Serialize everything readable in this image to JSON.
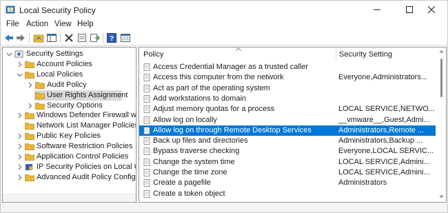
{
  "window": {
    "title": "Local Security Policy"
  },
  "menu": [
    "File",
    "Action",
    "View",
    "Help"
  ],
  "toolbar": {
    "buttons": [
      "back-arrow-icon",
      "forward-arrow-icon",
      "up-folder-icon",
      "show-hide-tree-icon",
      "delete-icon",
      "properties-icon",
      "export-list-icon",
      "help-icon",
      "console-icon"
    ]
  },
  "tree": {
    "items": [
      {
        "label": "Security Settings",
        "level": 0,
        "expanded": true
      },
      {
        "label": "Account Policies",
        "level": 1,
        "expanded": false
      },
      {
        "label": "Local Policies",
        "level": 1,
        "expanded": true
      },
      {
        "label": "Audit Policy",
        "level": 2,
        "expanded": false
      },
      {
        "label": "User Rights Assignment",
        "level": 2,
        "selected": true
      },
      {
        "label": "Security Options",
        "level": 2,
        "expanded": false
      },
      {
        "label": "Windows Defender Firewall with Adva",
        "level": 1,
        "expanded": false
      },
      {
        "label": "Network List Manager Policies",
        "level": 1
      },
      {
        "label": "Public Key Policies",
        "level": 1,
        "expanded": false
      },
      {
        "label": "Software Restriction Policies",
        "level": 1,
        "expanded": false
      },
      {
        "label": "Application Control Policies",
        "level": 1,
        "expanded": false
      },
      {
        "label": "IP Security Policies on Local Compute",
        "level": 1,
        "expanded": false
      },
      {
        "label": "Advanced Audit Policy Configuration",
        "level": 1,
        "expanded": false
      }
    ]
  },
  "list": {
    "columns": [
      "Policy",
      "Security Setting"
    ],
    "rows": [
      {
        "policy": "Access Credential Manager as a trusted caller",
        "setting": ""
      },
      {
        "policy": "Access this computer from the network",
        "setting": "Everyone,Administrators..."
      },
      {
        "policy": "Act as part of the operating system",
        "setting": ""
      },
      {
        "policy": "Add workstations to domain",
        "setting": ""
      },
      {
        "policy": "Adjust memory quotas for a process",
        "setting": "LOCAL SERVICE,NETWO..."
      },
      {
        "policy": "Allow log on locally",
        "setting": "__vmware__,Guest,Admi..."
      },
      {
        "policy": "Allow log on through Remote Desktop Services",
        "setting": "Administrators,Remote ...",
        "selected": true
      },
      {
        "policy": "Back up files and directories",
        "setting": "Administrators,Backup ..."
      },
      {
        "policy": "Bypass traverse checking",
        "setting": "Everyone,LOCAL SERVIC..."
      },
      {
        "policy": "Change the system time",
        "setting": "LOCAL SERVICE,Admini..."
      },
      {
        "policy": "Change the time zone",
        "setting": "LOCAL SERVICE,Admini..."
      },
      {
        "policy": "Create a pagefile",
        "setting": "Administrators"
      },
      {
        "policy": "Create a token object",
        "setting": ""
      }
    ]
  },
  "colors": {
    "selection": "#0078d7",
    "tree_selection": "#d9d9d9",
    "folder": "#e8b73a"
  }
}
